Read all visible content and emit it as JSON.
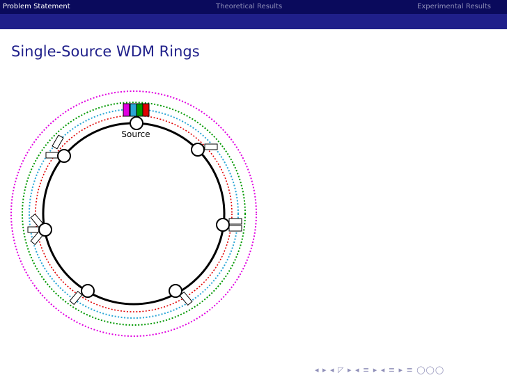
{
  "header": {
    "sections": [
      {
        "label": "Problem Statement",
        "active": true
      },
      {
        "label": "Theoretical Results",
        "active": false
      },
      {
        "label": "Experimental Results",
        "active": false
      }
    ]
  },
  "slide": {
    "title": "Single-Source WDM Rings",
    "source_label": "Source"
  },
  "diagram": {
    "nodes_count": 7,
    "rings": [
      {
        "color": "#e000e0"
      },
      {
        "color": "#009900"
      },
      {
        "color": "#2aa6d6"
      },
      {
        "color": "#e00000"
      }
    ],
    "source_wavelength_colors": [
      "#e000e0",
      "#2aa6d6",
      "#009900",
      "#e00000"
    ]
  },
  "footer": {
    "nav_symbols": "◂ ▸ ◂ ◸ ▸ ◂ ≡ ▸ ◂ ≡ ▸ ≡ ◯◯◯"
  }
}
